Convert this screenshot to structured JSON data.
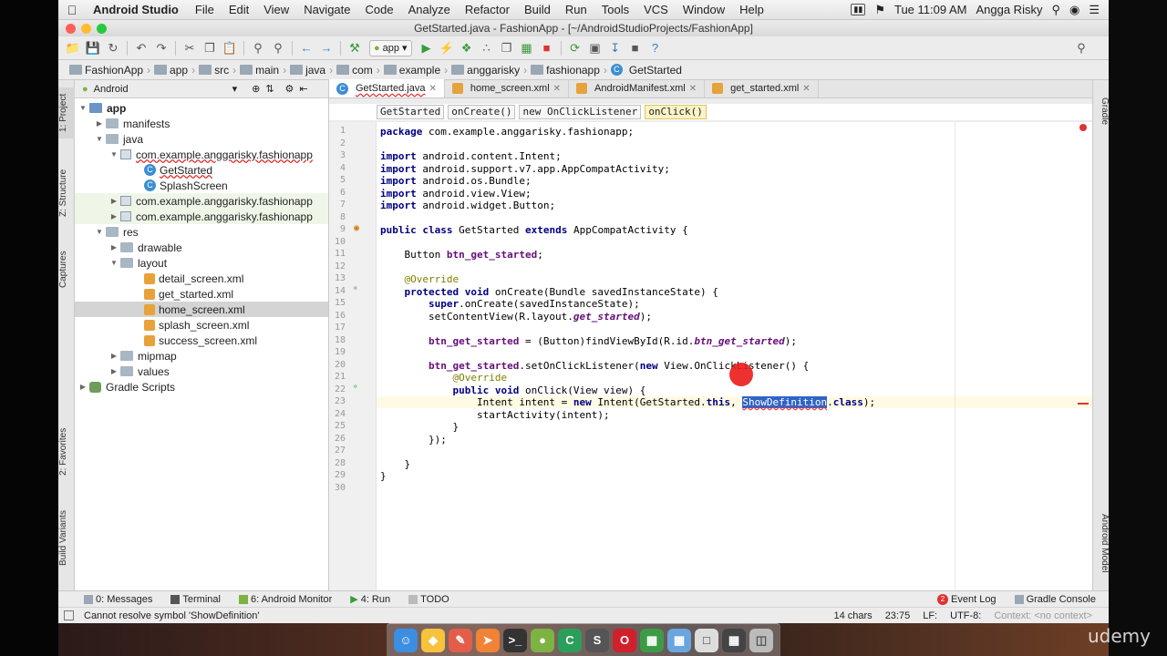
{
  "menubar": {
    "app_name": "Android Studio",
    "menus": [
      "File",
      "Edit",
      "View",
      "Navigate",
      "Code",
      "Analyze",
      "Refactor",
      "Build",
      "Run",
      "Tools",
      "VCS",
      "Window",
      "Help"
    ],
    "clock": "Tue 11:09 AM",
    "user": "Angga Risky"
  },
  "window": {
    "title": "GetStarted.java - FashionApp - [~/AndroidStudioProjects/FashionApp]"
  },
  "toolbar": {
    "run_config": "app"
  },
  "breadcrumbs": [
    "FashionApp",
    "app",
    "src",
    "main",
    "java",
    "com",
    "example",
    "anggarisky",
    "fashionapp",
    "GetStarted"
  ],
  "left_strip": {
    "project": "1: Project",
    "structure": "Z: Structure",
    "captures": "Captures",
    "favorites": "2: Favorites",
    "build_variants": "Build Variants"
  },
  "right_strip": {
    "gradle": "Gradle",
    "android_model": "Android Model"
  },
  "project_panel": {
    "view_mode": "Android",
    "tree": {
      "app": "app",
      "manifests": "manifests",
      "java": "java",
      "pkg_main": "com.example.anggarisky.fashionapp",
      "class_getstarted": "GetStarted",
      "class_splash": "SplashScreen",
      "pkg_android_test": "com.example.anggarisky.fashionapp",
      "pkg_test": "com.example.anggarisky.fashionapp",
      "res": "res",
      "drawable": "drawable",
      "layout": "layout",
      "detail_screen": "detail_screen.xml",
      "get_started": "get_started.xml",
      "home_screen": "home_screen.xml",
      "splash_screen": "splash_screen.xml",
      "success_screen": "success_screen.xml",
      "mipmap": "mipmap",
      "values": "values",
      "gradle_scripts": "Gradle Scripts"
    }
  },
  "editor_tabs": [
    "GetStarted.java",
    "home_screen.xml",
    "AndroidManifest.xml",
    "get_started.xml"
  ],
  "method_bar": [
    "GetStarted",
    "onCreate()",
    "new OnClickListener",
    "onClick()"
  ],
  "code": {
    "l1_kw": "package",
    "l1": " com.example.anggarisky.fashionapp;",
    "l3_kw": "import",
    "l3": " android.content.Intent;",
    "l4_kw": "import",
    "l4": " android.support.v7.app.AppCompatActivity;",
    "l5_kw": "import",
    "l5": " android.os.Bundle;",
    "l6_kw": "import",
    "l6": " android.view.View;",
    "l7_kw": "import",
    "l7": " android.widget.Button;",
    "l9_kw1": "public class",
    "l9_a": " GetStarted ",
    "l9_kw2": "extends",
    "l9_b": " AppCompatActivity {",
    "l11_a": "    Button ",
    "l11_f": "btn_get_started",
    "l11_b": ";",
    "l13": "    @Override",
    "l14_kw": "    protected void",
    "l14": " onCreate(Bundle savedInstanceState) {",
    "l15_kw": "        super",
    "l15": ".onCreate(savedInstanceState);",
    "l16_a": "        setContentView(R.layout.",
    "l16_f": "get_started",
    "l16_b": ");",
    "l18_f": "        btn_get_started",
    "l18_a": " = (Button)findViewById(R.id.",
    "l18_fi": "btn_get_started",
    "l18_b": ");",
    "l20_f": "        btn_get_started",
    "l20_a": ".setOnClickListener(",
    "l20_kw": "new",
    "l20_b": " View.OnClickListener() {",
    "l21": "            @Override",
    "l22_kw": "            public void",
    "l22": " onClick(View view) {",
    "l23_a": "                Intent intent = ",
    "l23_kw": "new",
    "l23_b": " Intent(GetStarted.",
    "l23_kw2": "this",
    "l23_c": ", ",
    "l23_err": "ShowDefinition",
    "l23_d": ".",
    "l23_kw3": "class",
    "l23_e": ");",
    "l24": "                startActivity(intent);",
    "l25": "            }",
    "l26": "        });",
    "l28": "    }",
    "l29": "}"
  },
  "line_numbers": [
    "1",
    "2",
    "3",
    "4",
    "5",
    "6",
    "7",
    "8",
    "9",
    "10",
    "11",
    "12",
    "13",
    "14",
    "15",
    "16",
    "17",
    "18",
    "19",
    "20",
    "21",
    "22",
    "23",
    "24",
    "25",
    "26",
    "27",
    "28",
    "29",
    "30"
  ],
  "bottom_tools": {
    "messages": "0: Messages",
    "terminal": "Terminal",
    "android_monitor": "6: Android Monitor",
    "run": "4: Run",
    "todo": "TODO",
    "event_log": "Event Log",
    "event_log_count": "2",
    "gradle_console": "Gradle Console"
  },
  "status": {
    "message": "Cannot resolve symbol 'ShowDefinition'",
    "chars": "14 chars",
    "position": "23:75",
    "line_sep": "LF:",
    "encoding": "UTF-8:",
    "context": "Context: <no context>"
  },
  "watermark": "udemy",
  "colors": {
    "keyword": "#000080",
    "field": "#660e7a",
    "annotation": "#808000",
    "selection": "#2f63c6"
  }
}
